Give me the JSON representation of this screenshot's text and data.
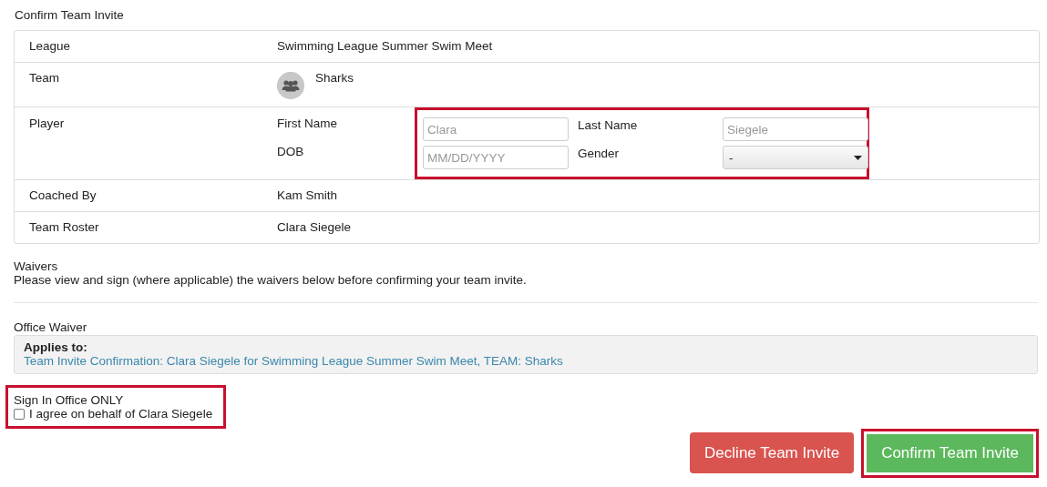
{
  "heading": "Confirm Team Invite",
  "details": [
    {
      "kind": "text",
      "label": "League",
      "value": "Swimming League Summer Swim Meet"
    },
    {
      "kind": "team",
      "label": "Team",
      "value": "Sharks"
    },
    {
      "kind": "player",
      "label": "Player",
      "highlighted": true,
      "fields": [
        {
          "kind": "input",
          "label": "First Name",
          "placeholder": "Clara"
        },
        {
          "kind": "input",
          "label": "Last Name",
          "placeholder": "Siegele"
        },
        {
          "kind": "input",
          "label": "DOB",
          "placeholder": "MM/DD/YYYY"
        },
        {
          "kind": "select",
          "label": "Gender",
          "value": "-"
        }
      ]
    },
    {
      "kind": "text",
      "label": "Coached By",
      "value": "Kam Smith"
    },
    {
      "kind": "text",
      "label": "Team Roster",
      "value": "Clara Siegele"
    }
  ],
  "waivers": {
    "title": "Waivers",
    "intro": "Please view and sign (where applicable) the waivers below before confirming your team invite."
  },
  "office_waiver": {
    "title": "Office Waiver",
    "applies_label": "Applies to:",
    "applies_link": "Team Invite Confirmation: Clara Siegele for Swimming League Summer Swim Meet, TEAM: Sharks"
  },
  "sign": {
    "title": "Sign In Office ONLY",
    "agree": "I agree on behalf of Clara Siegele",
    "checked": false,
    "highlighted": true
  },
  "buttons": [
    {
      "kind": "decline",
      "label": "Decline Team Invite",
      "highlighted": false
    },
    {
      "kind": "confirm",
      "label": "Confirm Team Invite",
      "highlighted": true
    }
  ]
}
